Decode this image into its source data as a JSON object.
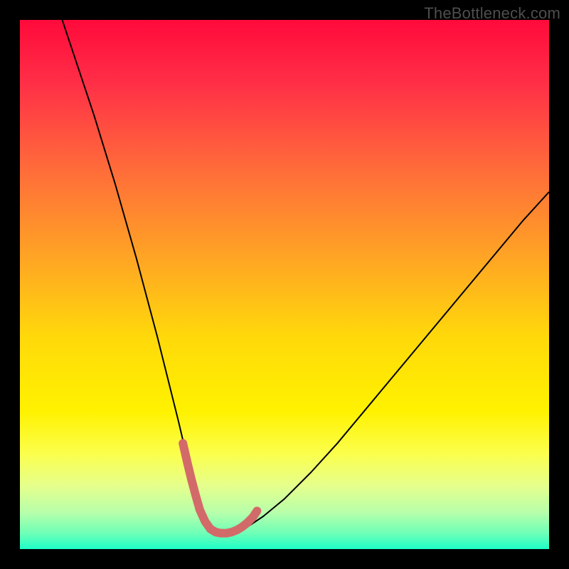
{
  "watermark": "TheBottleneck.com",
  "chart_data": {
    "type": "line",
    "title": "",
    "xlabel": "",
    "ylabel": "",
    "xlim": [
      0,
      100
    ],
    "ylim": [
      0,
      100
    ],
    "grid": false,
    "legend": false,
    "annotations": [
      {
        "text": "TheBottleneck.com",
        "position": "top-right"
      }
    ],
    "background_gradient_stops": [
      {
        "offset": 0.0,
        "color": "#ff0a3b"
      },
      {
        "offset": 0.12,
        "color": "#ff2f47"
      },
      {
        "offset": 0.28,
        "color": "#ff6b3a"
      },
      {
        "offset": 0.45,
        "color": "#ffa524"
      },
      {
        "offset": 0.6,
        "color": "#ffd90a"
      },
      {
        "offset": 0.74,
        "color": "#fff200"
      },
      {
        "offset": 0.82,
        "color": "#fbff4d"
      },
      {
        "offset": 0.88,
        "color": "#e6ff8c"
      },
      {
        "offset": 0.93,
        "color": "#b8ffaa"
      },
      {
        "offset": 0.97,
        "color": "#6fffb7"
      },
      {
        "offset": 1.0,
        "color": "#1effc8"
      }
    ],
    "series": [
      {
        "name": "bottleneck-curve",
        "color": "#000000",
        "stroke_width": 2,
        "x": [
          8,
          10,
          12,
          14,
          16,
          18,
          20,
          22,
          24,
          26,
          28,
          30,
          32,
          33.5,
          34.5,
          35.5,
          36.5,
          38,
          40,
          43,
          46,
          50,
          55,
          60,
          65,
          70,
          75,
          80,
          85,
          90,
          95,
          100
        ],
        "values": [
          100,
          94,
          88,
          82,
          75.5,
          69,
          62,
          55,
          47.5,
          40,
          32,
          24,
          15.5,
          9,
          5,
          3.5,
          3,
          3,
          3.3,
          4.2,
          6.2,
          9.5,
          14.5,
          20,
          26,
          32,
          38,
          44,
          50,
          56,
          62,
          67.5
        ]
      },
      {
        "name": "optimal-zone-marker",
        "color": "#d36a6a",
        "stroke_width": 12,
        "linecap": "round",
        "x": [
          30.8,
          31.6,
          32.4,
          33.2,
          34.0,
          35.0,
          36.0,
          37.0,
          38.0,
          39.0,
          40.0,
          41.0,
          42.0,
          43.0,
          44.0,
          44.8
        ],
        "values": [
          20.0,
          16.5,
          13.2,
          10.2,
          7.4,
          5.2,
          3.8,
          3.2,
          3.0,
          3.0,
          3.2,
          3.6,
          4.2,
          5.0,
          6.0,
          7.2
        ]
      }
    ]
  }
}
